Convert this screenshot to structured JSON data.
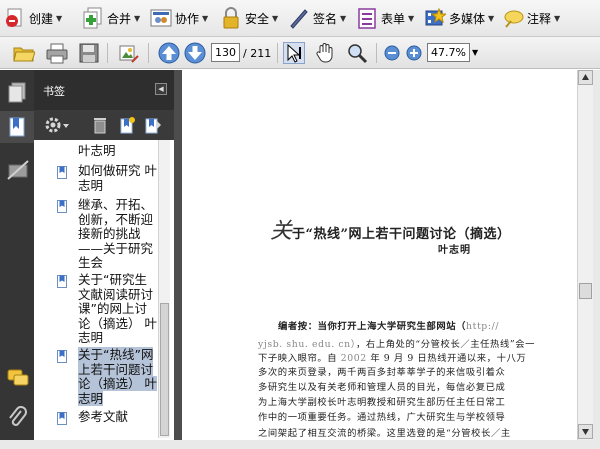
{
  "toolbar": {
    "create_label": "创建",
    "combine_label": "合并",
    "collaborate_label": "协作",
    "secure_label": "安全",
    "sign_label": "签名",
    "forms_label": "表单",
    "multimedia_label": "多媒体",
    "comment_label": "注释"
  },
  "nav": {
    "page_current": "130",
    "page_total": "/ 211",
    "zoom": "47.7%"
  },
  "icons": {
    "open": "folder-open-icon",
    "print": "printer-icon",
    "save": "floppy-disk-icon",
    "prev": "arrow-up-icon",
    "next": "arrow-down-icon",
    "select": "select-cursor-icon",
    "hand": "hand-icon",
    "marquee": "marquee-zoom-icon",
    "zoom_out": "zoom-out-icon",
    "zoom_in": "zoom-in-icon"
  },
  "bookmarks": {
    "panel_title": "书签",
    "items": [
      {
        "label": "叶志明"
      },
      {
        "label": "如何做研究 叶志明"
      },
      {
        "label": "继承、开拓、创新，不断迎接新的挑战——关于研究生会"
      },
      {
        "label": "关于“研究生文献阅读研讨课”的网上讨论（摘选）  叶志明"
      },
      {
        "label": "关于“热线”网上若干问题讨论（摘选）  叶志明"
      },
      {
        "label": "参考文献"
      }
    ]
  },
  "document": {
    "title_big": "关",
    "title_rest": "于“热线”网上若干问题讨论（摘选）",
    "author": "叶志明",
    "lines": [
      {
        "text": "编者按：当你打开上海大学研究生部网站（",
        "grey": "http://"
      },
      {
        "text": "",
        "grey": "yjsb. shu. edu. cn）",
        "tail": "，右上角处的“分管校长／主任热线”会一"
      },
      {
        "text": "下子映入眼帘。自 ",
        "grey": "2002",
        "tail": " 年 9 月 9 日热线开通以来，十八万"
      },
      {
        "text": "多次的来页登录，两千两百多封莘莘学子的来信吸引着众"
      },
      {
        "text": "多研究生以及有关老师和管理人员的目光，每信必复已成"
      },
      {
        "text": "为上海大学副校长叶志明教授和研究生部历任主任日常工"
      },
      {
        "text": "作中的一项重要任务。通过热线，广大研究生与学校领导"
      },
      {
        "text": "之间架起了相互交流的桥梁。这里选登的是“分管校长／主"
      }
    ]
  },
  "colors": {
    "rail_bg": "#353535",
    "selection": "#b4c3d8",
    "toolbar_bg": "#ececec"
  }
}
